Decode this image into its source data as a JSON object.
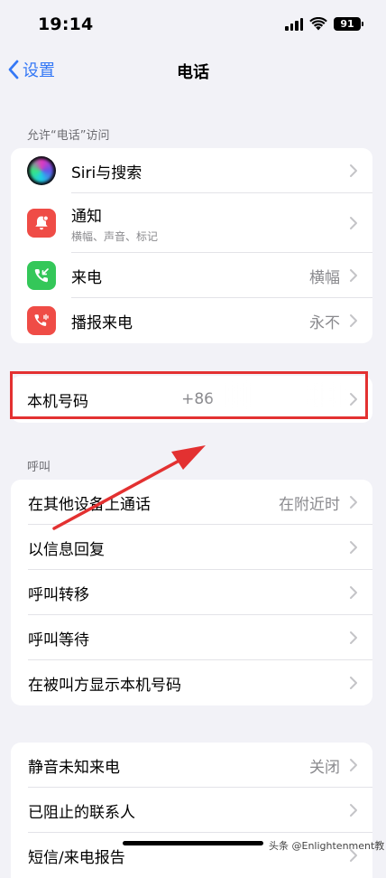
{
  "status_bar": {
    "time": "19:14",
    "battery": "91"
  },
  "nav": {
    "back_label": "设置",
    "title": "电话"
  },
  "sections": {
    "allow_access_header": "允许“电话”访问",
    "calls_header": "呼叫"
  },
  "access_group": [
    {
      "label": "Siri与搜索",
      "icon": "siri-icon",
      "value": ""
    },
    {
      "label": "通知",
      "sublabel": "横幅、声音、标记",
      "icon": "notification-bell-icon",
      "value": ""
    },
    {
      "label": "来电",
      "icon": "incoming-call-icon",
      "value": "横幅"
    },
    {
      "label": "播报来电",
      "icon": "announce-calls-icon",
      "value": "永不"
    }
  ],
  "my_number": {
    "label": "本机号码",
    "value": "+86"
  },
  "calls_group": [
    {
      "label": "在其他设备上通话",
      "value": "在附近时"
    },
    {
      "label": "以信息回复",
      "value": ""
    },
    {
      "label": "呼叫转移",
      "value": ""
    },
    {
      "label": "呼叫等待",
      "value": ""
    },
    {
      "label": "在被叫方显示本机号码",
      "value": ""
    }
  ],
  "blocking_group": [
    {
      "label": "静音未知来电",
      "value": "关闭"
    },
    {
      "label": "已阻止的联系人",
      "value": ""
    },
    {
      "label": "短信/来电报告",
      "value": ""
    }
  ],
  "watermark": "头条 @Enlightenment教",
  "colors": {
    "accent": "#3478f6",
    "highlight": "#e33131",
    "notification_icon": "#ef4c46",
    "incoming_call_icon": "#34c759",
    "announce_icon": "#ef4c46"
  }
}
